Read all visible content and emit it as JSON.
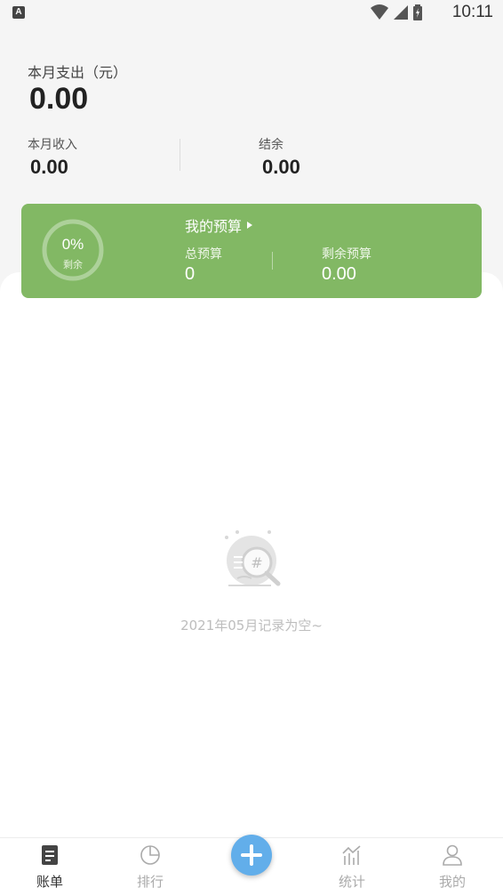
{
  "status_bar": {
    "time": "10:11",
    "notification_icon": "A"
  },
  "summary": {
    "expense_label": "本月支出（元）",
    "expense_value": "0.00",
    "income_label": "本月收入",
    "income_value": "0.00",
    "balance_label": "结余",
    "balance_value": "0.00"
  },
  "budget": {
    "title": "我的预算",
    "percent": "0%",
    "percent_sub": "剩余",
    "total_label": "总预算",
    "total_value": "0",
    "remaining_label": "剩余预算",
    "remaining_value": "0.00",
    "color": "#82b864"
  },
  "empty_state": {
    "text": "2021年05月记录为空~"
  },
  "nav": {
    "items": [
      {
        "label": "账单",
        "icon": "bill-icon",
        "active": true
      },
      {
        "label": "排行",
        "icon": "pie-chart-icon",
        "active": false
      },
      {
        "label": "",
        "icon": "plus-icon",
        "active": false
      },
      {
        "label": "统计",
        "icon": "stats-icon",
        "active": false
      },
      {
        "label": "我的",
        "icon": "user-icon",
        "active": false
      }
    ],
    "fab_color": "#62aeea"
  }
}
